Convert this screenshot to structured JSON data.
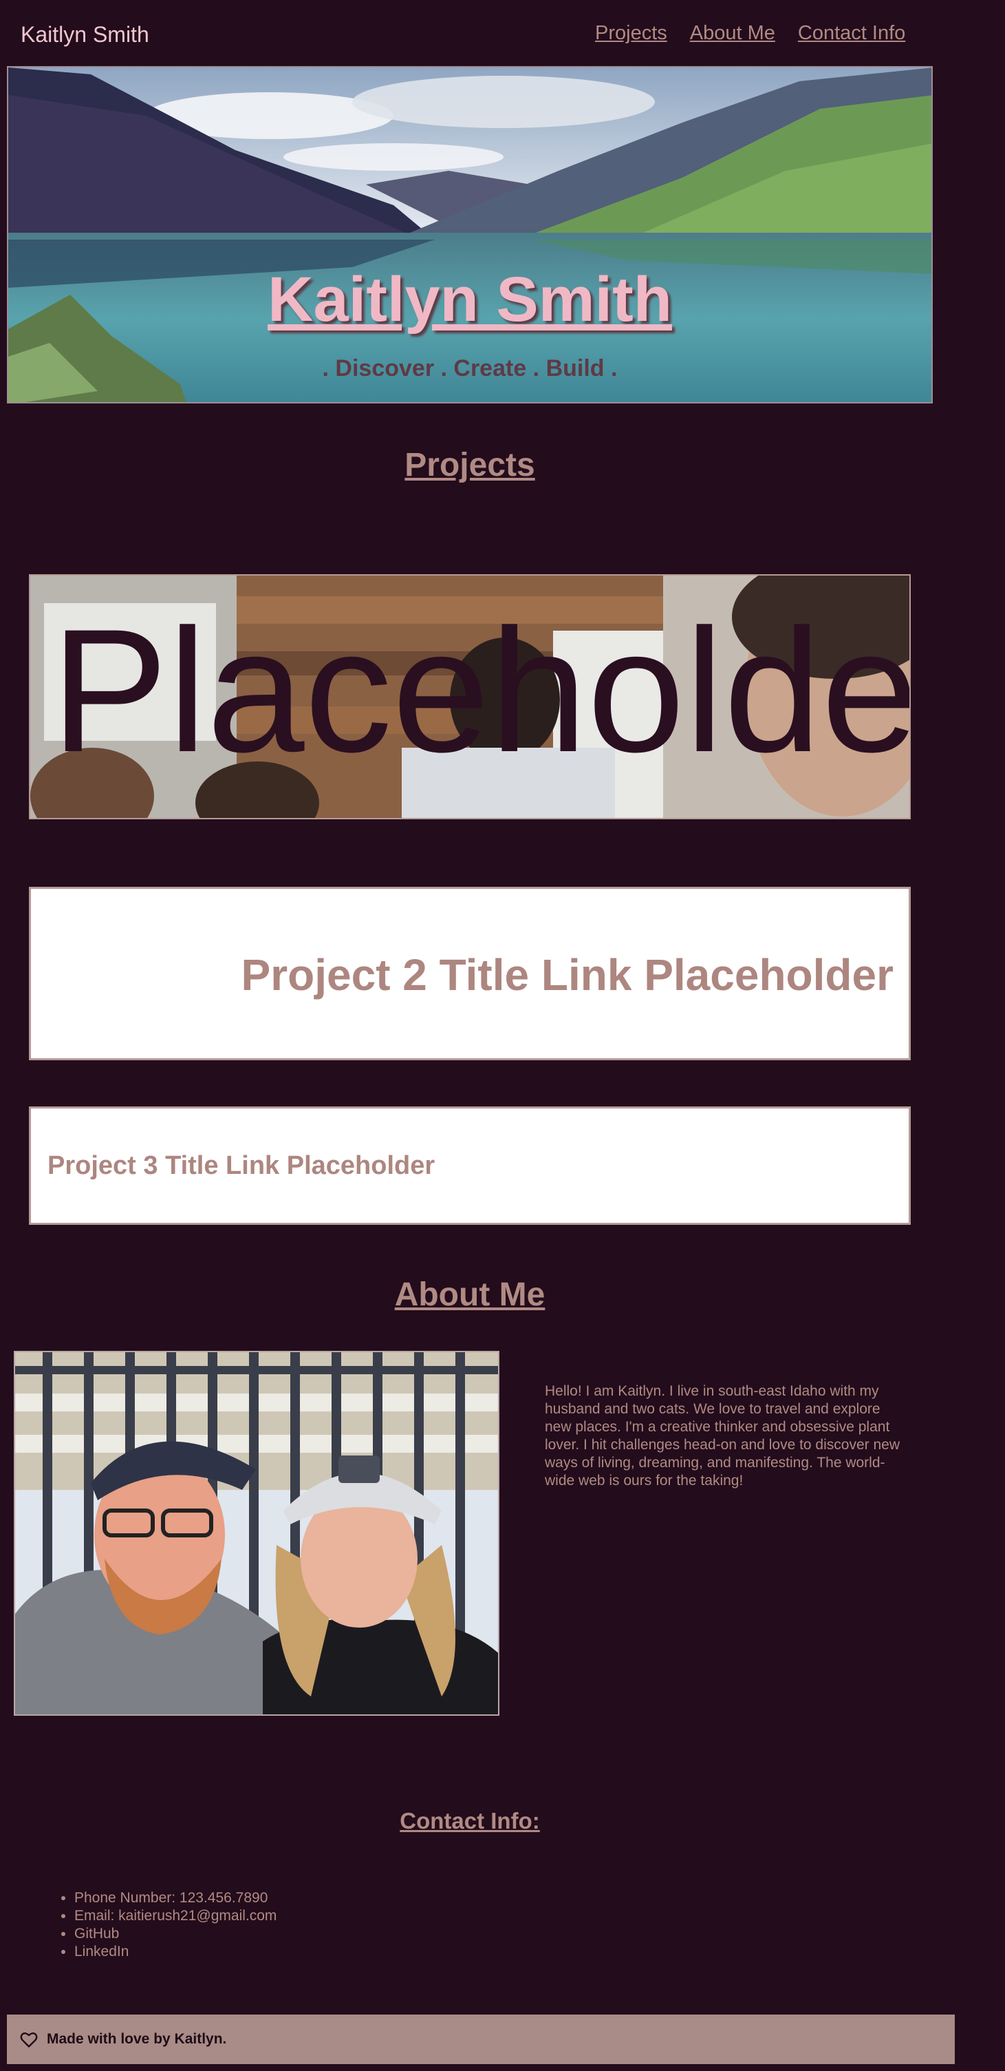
{
  "header": {
    "site_name": "Kaitlyn Smith",
    "nav": [
      "Projects",
      "About Me",
      "Contact Info"
    ]
  },
  "hero": {
    "title": "Kaitlyn Smith",
    "tagline": ". Discover . Create . Build ."
  },
  "projects": {
    "heading": "Projects",
    "project1_label": "Placeholder",
    "project2_label": "Project 2 Title Link Placeholder",
    "project3_label": "Project 3 Title Link Placeholder"
  },
  "about": {
    "heading": "About Me",
    "text": "Hello! I am Kaitlyn. I live in south-east Idaho with my husband and two cats. We love to travel and explore new places. I'm a creative thinker and obsessive plant lover. I hit challenges head-on and love to discover new ways of living, dreaming, and manifesting. The world-wide web is ours for the taking!"
  },
  "contact": {
    "heading": "Contact Info:",
    "items": [
      "Phone Number: 123.456.7890",
      "Email: kaitierush21@gmail.com",
      "GitHub",
      "LinkedIn"
    ]
  },
  "footer": {
    "text": "Made with love by Kaitlyn.",
    "icon": "heart-icon"
  },
  "colors": {
    "background": "#230c1b",
    "accent": "#b08a84",
    "hero_title": "#f0b8c5",
    "footer_bg": "#a98c87"
  }
}
